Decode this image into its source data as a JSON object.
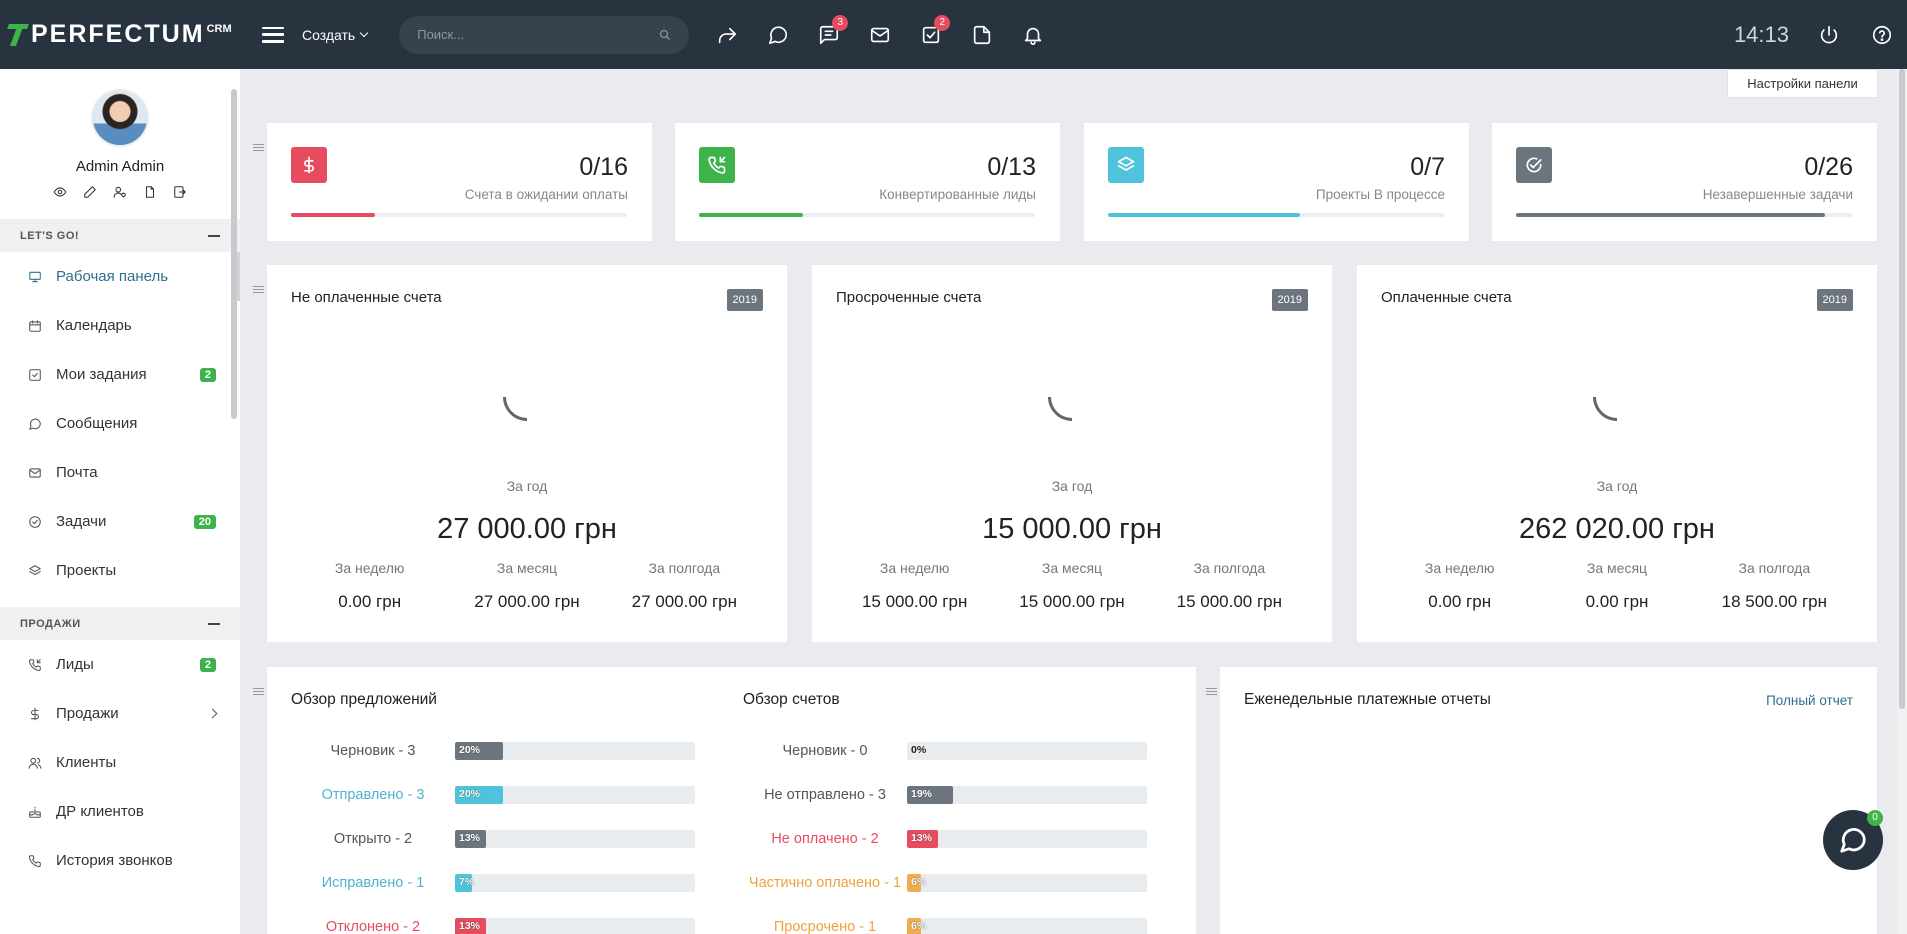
{
  "topbar": {
    "logo_text": "PERFECTUM",
    "logo_sup": "CRM",
    "create_label": "Создать",
    "search_placeholder": "Поиск...",
    "icons": [
      {
        "name": "share-icon",
        "badge": ""
      },
      {
        "name": "chat-icon",
        "badge": ""
      },
      {
        "name": "messages-icon",
        "badge": "3"
      },
      {
        "name": "mail-icon",
        "badge": ""
      },
      {
        "name": "tasks-icon",
        "badge": "2"
      },
      {
        "name": "document-icon",
        "badge": ""
      },
      {
        "name": "bell-icon",
        "badge": ""
      }
    ],
    "time": "14:13"
  },
  "sidebar": {
    "username": "Admin Admin",
    "section1": "LET'S GO!",
    "items1": [
      {
        "label": "Рабочая панель",
        "icon": "dashboard-icon",
        "badge": ""
      },
      {
        "label": "Календарь",
        "icon": "calendar-icon",
        "badge": ""
      },
      {
        "label": "Мои задания",
        "icon": "checkbox-icon",
        "badge": "2"
      },
      {
        "label": "Сообщения",
        "icon": "chat-icon",
        "badge": ""
      },
      {
        "label": "Почта",
        "icon": "mail-icon",
        "badge": ""
      },
      {
        "label": "Задачи",
        "icon": "check-circle-icon",
        "badge": "20"
      },
      {
        "label": "Проекты",
        "icon": "layers-icon",
        "badge": ""
      }
    ],
    "section2": "ПРОДАЖИ",
    "items2": [
      {
        "label": "Лиды",
        "icon": "phone-incoming-icon",
        "badge": "2"
      },
      {
        "label": "Продажи",
        "icon": "dollar-icon",
        "badge": ""
      },
      {
        "label": "Клиенты",
        "icon": "users-icon",
        "badge": ""
      },
      {
        "label": "ДР клиентов",
        "icon": "cake-icon",
        "badge": ""
      },
      {
        "label": "История звонков",
        "icon": "phone-icon",
        "badge": ""
      }
    ]
  },
  "panel_settings": "Настройки панели",
  "stats": [
    {
      "value": "0/16",
      "label": "Счета в ожидании оплаты",
      "color": "#e74c5e",
      "progress": 0.25
    },
    {
      "value": "0/13",
      "label": "Конвертированные лиды",
      "color": "#3cb44a",
      "progress": 0.31
    },
    {
      "value": "0/7",
      "label": "Проекты В процессе",
      "color": "#4fc3dc",
      "progress": 0.57
    },
    {
      "value": "0/26",
      "label": "Незавершенные задачи",
      "color": "#6c757d",
      "progress": 0.92
    }
  ],
  "invoices": [
    {
      "title": "Не оплаченные счета",
      "year": "2019",
      "period": "За год",
      "total": "27 000.00 грн",
      "cols": [
        {
          "l": "За неделю",
          "v": "0.00 грн"
        },
        {
          "l": "За месяц",
          "v": "27 000.00 грн"
        },
        {
          "l": "За полгода",
          "v": "27 000.00 грн"
        }
      ]
    },
    {
      "title": "Просроченные счета",
      "year": "2019",
      "period": "За год",
      "total": "15 000.00 грн",
      "cols": [
        {
          "l": "За неделю",
          "v": "15 000.00 грн"
        },
        {
          "l": "За месяц",
          "v": "15 000.00 грн"
        },
        {
          "l": "За полгода",
          "v": "15 000.00 грн"
        }
      ]
    },
    {
      "title": "Оплаченные счета",
      "year": "2019",
      "period": "За год",
      "total": "262 020.00 грн",
      "cols": [
        {
          "l": "За неделю",
          "v": "0.00 грн"
        },
        {
          "l": "За месяц",
          "v": "0.00 грн"
        },
        {
          "l": "За полгода",
          "v": "18 500.00 грн"
        }
      ]
    }
  ],
  "proposals": {
    "title": "Обзор предложений",
    "rows": [
      {
        "label": "Черновик - 3",
        "pct": "20%",
        "value": 20,
        "color": "#6c757d",
        "text_color": "#555"
      },
      {
        "label": "Отправлено - 3",
        "pct": "20%",
        "value": 20,
        "color": "#4fc3dc",
        "text_color": "#4fb3d0"
      },
      {
        "label": "Открыто - 2",
        "pct": "13%",
        "value": 13,
        "color": "#6c757d",
        "text_color": "#555"
      },
      {
        "label": "Исправлено - 1",
        "pct": "7%",
        "value": 7,
        "color": "#4fc3dc",
        "text_color": "#4fb3d0"
      },
      {
        "label": "Отклонено - 2",
        "pct": "13%",
        "value": 13,
        "color": "#e74c5e",
        "text_color": "#e74c5e"
      }
    ]
  },
  "invoice_overview": {
    "title": "Обзор счетов",
    "rows": [
      {
        "label": "Черновик - 0",
        "pct": "0%",
        "value": 0,
        "color": "#6c757d",
        "text_color": "#555"
      },
      {
        "label": "Не отправлено - 3",
        "pct": "19%",
        "value": 19,
        "color": "#6c757d",
        "text_color": "#555"
      },
      {
        "label": "Не оплачено - 2",
        "pct": "13%",
        "value": 13,
        "color": "#e74c5e",
        "text_color": "#e74c5e"
      },
      {
        "label": "Частично оплачено - 1",
        "pct": "6%",
        "value": 6,
        "color": "#f0ad4e",
        "text_color": "#f0a23a"
      },
      {
        "label": "Просрочено - 1",
        "pct": "6%",
        "value": 6,
        "color": "#f0ad4e",
        "text_color": "#f0a23a"
      }
    ]
  },
  "weekly": {
    "title": "Еженедельные платежные отчеты",
    "link": "Полный отчет"
  },
  "chat_count": "0"
}
